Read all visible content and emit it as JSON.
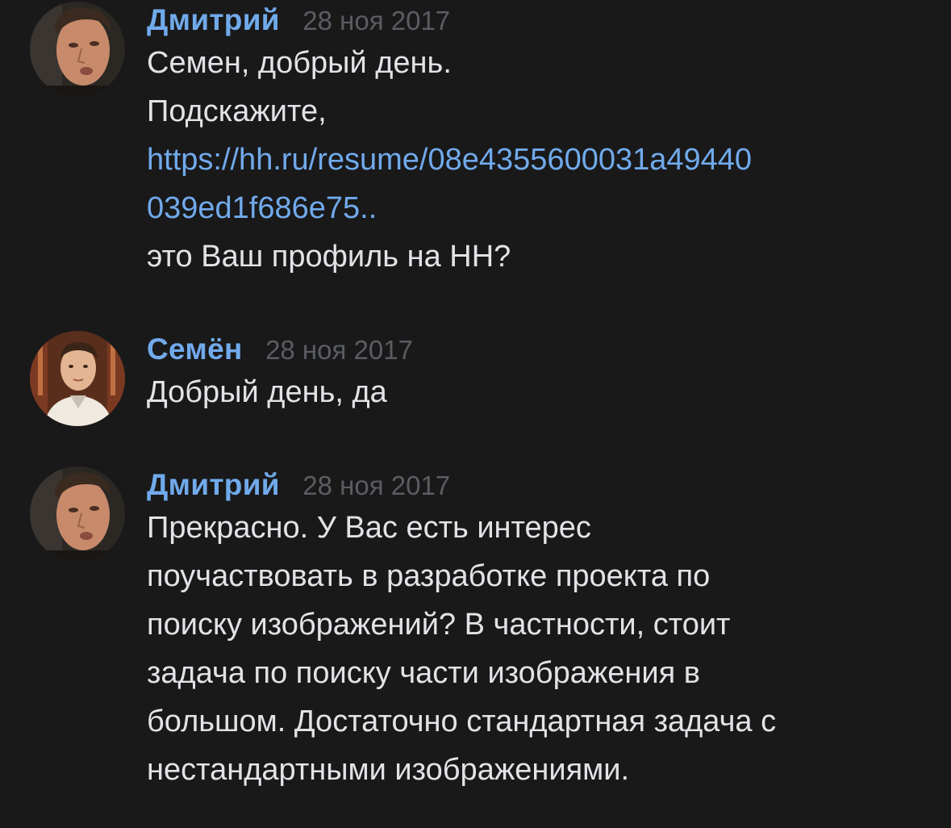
{
  "messages": [
    {
      "author": "Дмитрий",
      "date": "28 ноя 2017",
      "avatar_icon": "user-photo-dmitry",
      "lines": [
        {
          "text": "Семен, добрый день.",
          "type": "text"
        },
        {
          "text": "Подскажите,",
          "type": "text"
        },
        {
          "text": "https://hh.ru/resume/08e4355600031a49440",
          "type": "link"
        },
        {
          "text": "039ed1f686e75..",
          "type": "link"
        },
        {
          "text": "это Ваш профиль на НН?",
          "type": "text"
        }
      ]
    },
    {
      "author": "Семён",
      "date": "28 ноя 2017",
      "avatar_icon": "user-photo-semyon",
      "lines": [
        {
          "text": "Добрый день, да",
          "type": "text"
        }
      ]
    },
    {
      "author": "Дмитрий",
      "date": "28 ноя 2017",
      "avatar_icon": "user-photo-dmitry",
      "lines": [
        {
          "text": "Прекрасно. У Вас есть интерес",
          "type": "text"
        },
        {
          "text": "поучаствовать в разработке проекта по",
          "type": "text"
        },
        {
          "text": "поиску изображений? В частности, стоит",
          "type": "text"
        },
        {
          "text": "задача по поиску части изображения в",
          "type": "text"
        },
        {
          "text": "большом. Достаточно стандартная задача с",
          "type": "text"
        },
        {
          "text": "нестандартными изображениями.",
          "type": "text"
        }
      ]
    }
  ],
  "colors": {
    "background": "#19191a",
    "author": "#71aaeb",
    "link": "#71aaeb",
    "text": "#e1e3e6",
    "date": "#5a5d62"
  }
}
